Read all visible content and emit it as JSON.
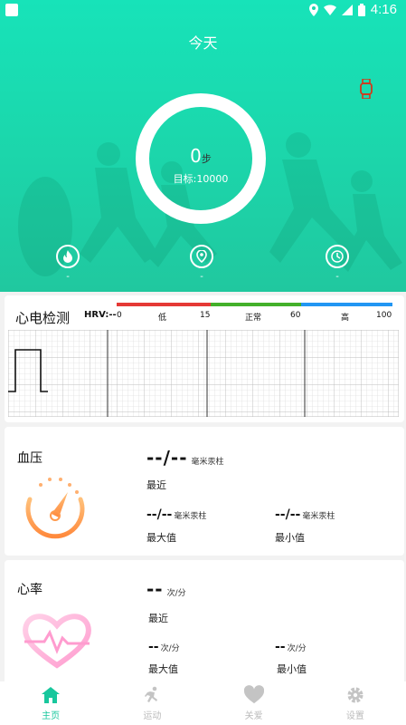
{
  "status_bar": {
    "time": "4:16"
  },
  "header": {
    "title": "今天",
    "steps": {
      "value": "0",
      "unit": "步"
    },
    "goal": "目标:10000",
    "stats": [
      {
        "icon": "flame-icon",
        "value": "-"
      },
      {
        "icon": "location-icon",
        "value": "-"
      },
      {
        "icon": "clock-icon",
        "value": "-"
      }
    ]
  },
  "ecg": {
    "title": "心电检测",
    "hrv_label": "HRV:--",
    "scale_numbers": [
      "0",
      "15",
      "60",
      "100"
    ],
    "scale_labels": [
      "低",
      "正常",
      "高"
    ],
    "colors": {
      "low": "#e53935",
      "normal": "#43b02a",
      "high": "#2196f3"
    }
  },
  "blood_pressure": {
    "title": "血压",
    "recent_value": "--/--",
    "unit": "毫米汞柱",
    "recent_label": "最近",
    "max_value": "--/--",
    "max_label": "最大值",
    "min_value": "--/--",
    "min_label": "最小值"
  },
  "heart_rate": {
    "title": "心率",
    "recent_value": "--",
    "unit": "次/分",
    "recent_label": "最近",
    "max_value": "--",
    "max_label": "最大值",
    "min_value": "--",
    "min_label": "最小值"
  },
  "tabs": [
    {
      "label": "主页",
      "icon": "home-icon",
      "active": true
    },
    {
      "label": "运动",
      "icon": "running-icon",
      "active": false
    },
    {
      "label": "关爱",
      "icon": "heart-icon",
      "active": false
    },
    {
      "label": "设置",
      "icon": "gear-icon",
      "active": false
    }
  ],
  "colors": {
    "accent": "#18c79d",
    "header": "#1bd8ad"
  }
}
